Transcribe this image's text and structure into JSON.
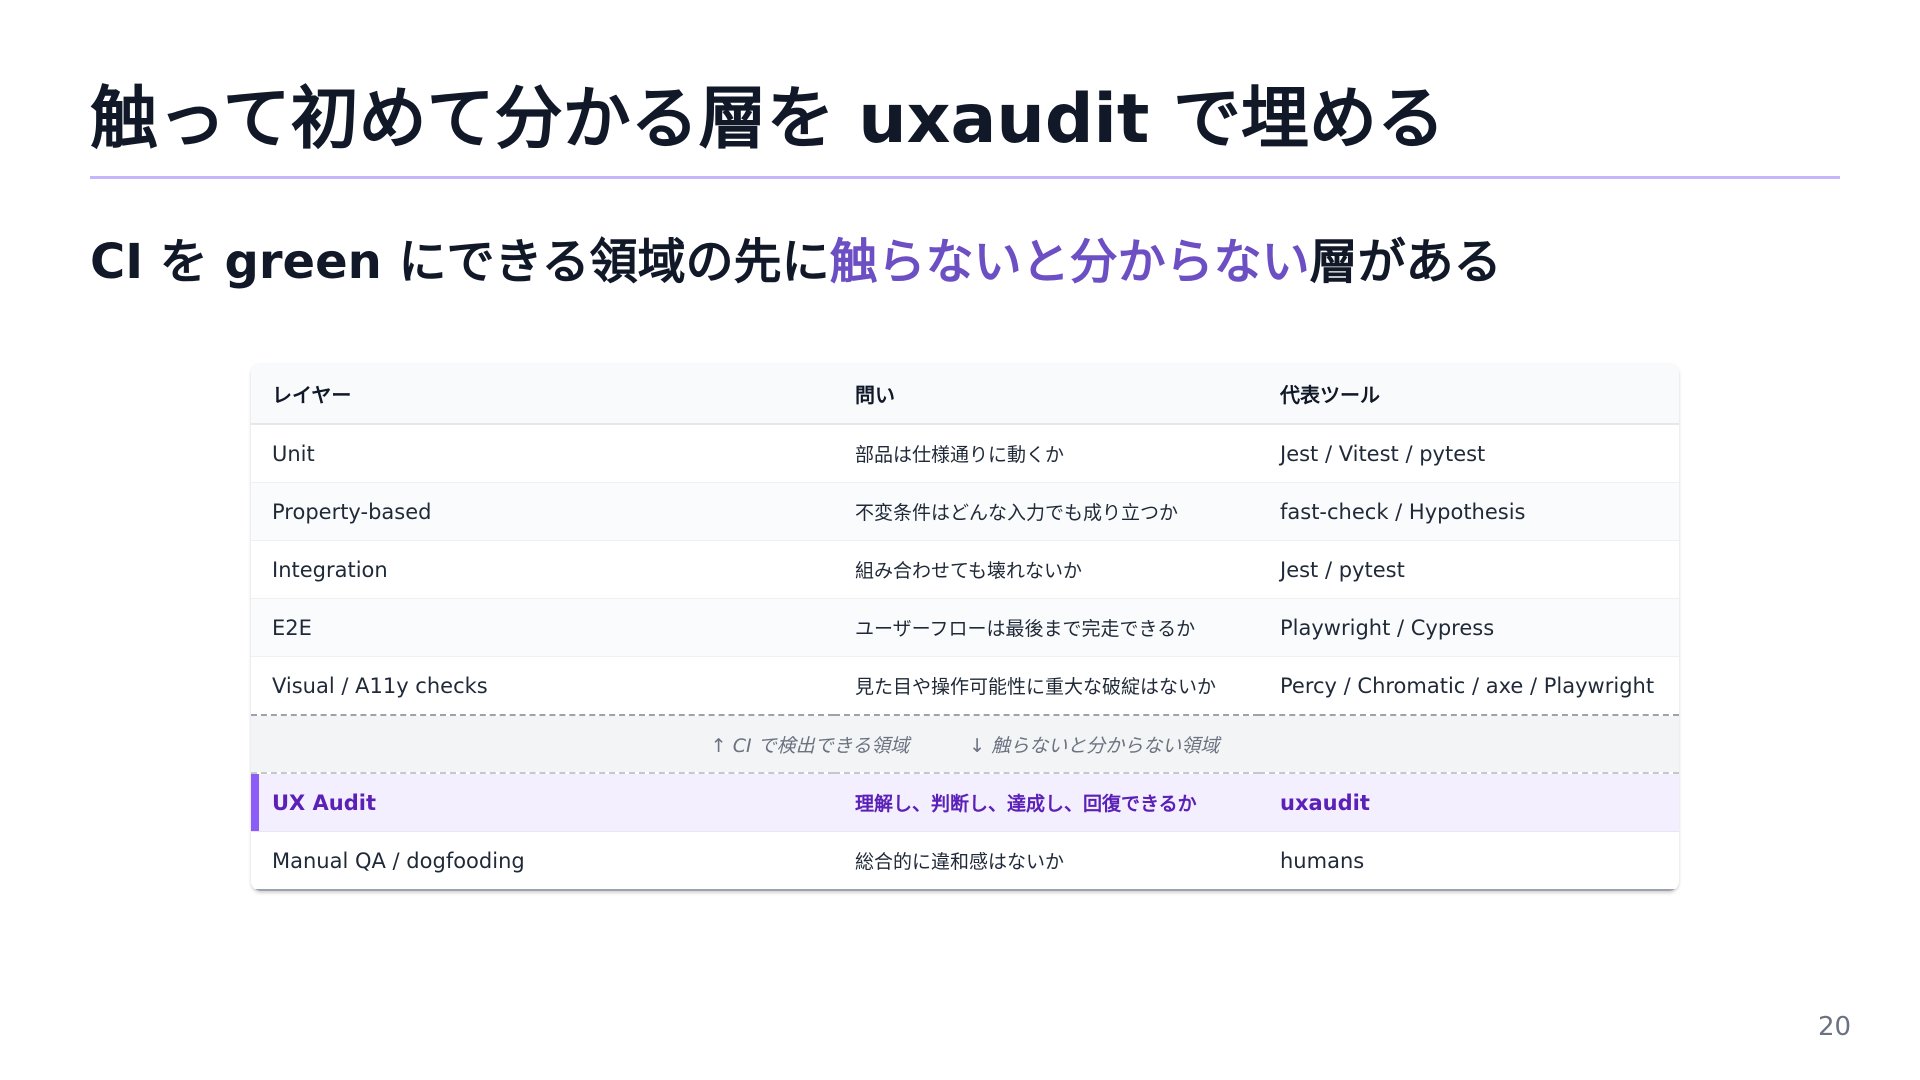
{
  "slide": {
    "title": "触って初めて分かる層を uxaudit で埋める",
    "subtitle_before": "CI を green にできる領域の先に",
    "subtitle_accent": "触らないと分からない",
    "subtitle_after": "層がある",
    "page_number": "20"
  },
  "table": {
    "headers": [
      "レイヤー",
      "問い",
      "代表ツール"
    ],
    "rows": [
      [
        "Unit",
        "部品は仕様通りに動くか",
        "Jest / Vitest / pytest"
      ],
      [
        "Property-based",
        "不変条件はどんな入力でも成り立つか",
        "fast-check / Hypothesis"
      ],
      [
        "Integration",
        "組み合わせても壊れないか",
        "Jest / pytest"
      ],
      [
        "E2E",
        "ユーザーフローは最後まで完走できるか",
        "Playwright / Cypress"
      ],
      [
        "Visual / A11y checks",
        "見た目や操作可能性に重大な破綻はないか",
        "Percy / Chromatic / axe / Playwright"
      ]
    ],
    "divider": {
      "above": "↑ CI で検出できる領域",
      "below": "↓ 触らないと分からない領域"
    },
    "highlight_row": [
      "UX Audit",
      "理解し、判断し、達成し、回復できるか",
      "uxaudit"
    ],
    "last_row": [
      "Manual QA / dogfooding",
      "総合的に違和感はないか",
      "humans"
    ]
  },
  "colors": {
    "accent": "#6d4fc4",
    "highlight_bar": "#8b5cf6",
    "highlight_text": "#5b21b6",
    "rule": "#c4b5fd"
  }
}
